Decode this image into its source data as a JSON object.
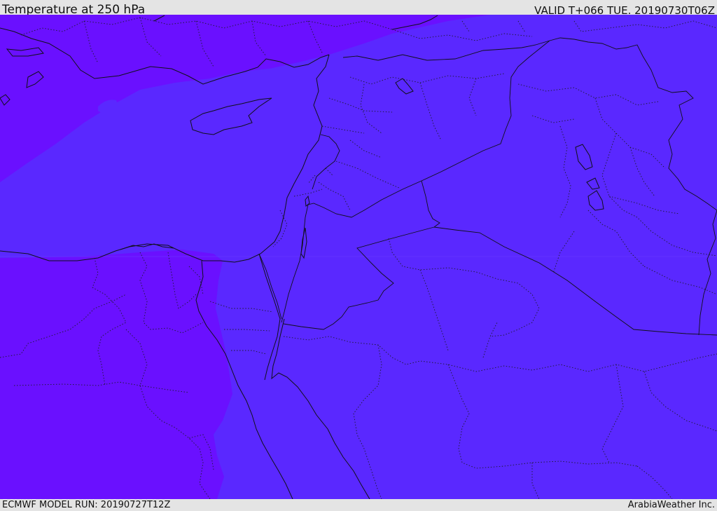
{
  "header": {
    "title": "Temperature at 250 hPa",
    "valid": "VALID T+066 TUE. 20190730T06Z"
  },
  "footer": {
    "model_run": "ECMWF MODEL RUN: 20190727T12Z",
    "credit": "ArabiaWeather Inc."
  },
  "colors": {
    "warm_band": "#5a28ff",
    "cool_band": "#6a10ff",
    "line": "#101018",
    "header_bg": "#e4e4e4"
  }
}
